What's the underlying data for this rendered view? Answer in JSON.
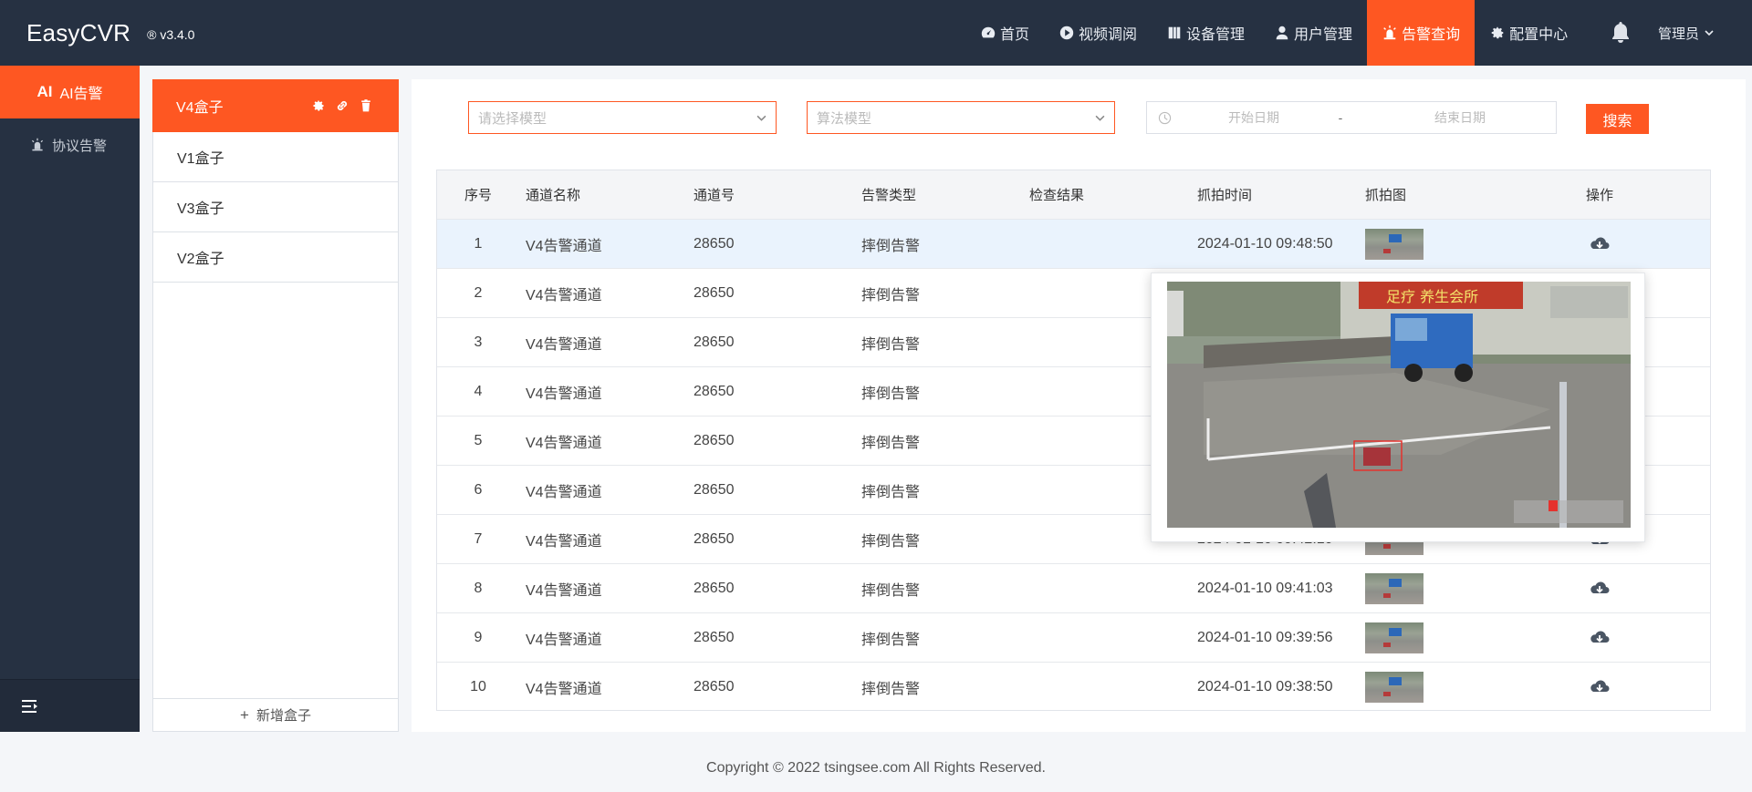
{
  "header": {
    "logo": "EasyCVR",
    "version": "® v3.4.0",
    "nav": [
      {
        "label": "首页",
        "icon": "dashboard-icon",
        "active": false
      },
      {
        "label": "视频调阅",
        "icon": "play-icon",
        "active": false
      },
      {
        "label": "设备管理",
        "icon": "book-icon",
        "active": false
      },
      {
        "label": "用户管理",
        "icon": "user-icon",
        "active": false
      },
      {
        "label": "告警查询",
        "icon": "alarm-icon",
        "active": true
      },
      {
        "label": "配置中心",
        "icon": "gear-icon",
        "active": false
      }
    ],
    "user": "管理员"
  },
  "sidebar": {
    "items": [
      {
        "label": "AI告警",
        "prefix": "AI",
        "active": true
      },
      {
        "label": "协议告警",
        "icon": "alarm-icon",
        "active": false
      }
    ]
  },
  "boxes": {
    "items": [
      {
        "label": "V4盒子",
        "active": true
      },
      {
        "label": "V1盒子",
        "active": false
      },
      {
        "label": "V3盒子",
        "active": false
      },
      {
        "label": "V2盒子",
        "active": false
      }
    ],
    "add_label": "新增盒子"
  },
  "filters": {
    "model_placeholder": "请选择模型",
    "algo_placeholder": "算法模型",
    "start_placeholder": "开始日期",
    "separator": "-",
    "end_placeholder": "结束日期",
    "search_label": "搜索"
  },
  "table": {
    "columns": [
      "序号",
      "通道名称",
      "通道号",
      "告警类型",
      "检查结果",
      "抓拍时间",
      "抓拍图",
      "操作"
    ],
    "rows": [
      {
        "no": "1",
        "name": "V4告警通道",
        "channel": "28650",
        "type": "摔倒告警",
        "result": "",
        "time": "2024-01-10 09:48:50"
      },
      {
        "no": "2",
        "name": "V4告警通道",
        "channel": "28650",
        "type": "摔倒告警",
        "result": "",
        "time": ""
      },
      {
        "no": "3",
        "name": "V4告警通道",
        "channel": "28650",
        "type": "摔倒告警",
        "result": "",
        "time": ""
      },
      {
        "no": "4",
        "name": "V4告警通道",
        "channel": "28650",
        "type": "摔倒告警",
        "result": "",
        "time": ""
      },
      {
        "no": "5",
        "name": "V4告警通道",
        "channel": "28650",
        "type": "摔倒告警",
        "result": "",
        "time": ""
      },
      {
        "no": "6",
        "name": "V4告警通道",
        "channel": "28650",
        "type": "摔倒告警",
        "result": "",
        "time": ""
      },
      {
        "no": "7",
        "name": "V4告警通道",
        "channel": "28650",
        "type": "摔倒告警",
        "result": "",
        "time": "2024-01-10 09:42:10"
      },
      {
        "no": "8",
        "name": "V4告警通道",
        "channel": "28650",
        "type": "摔倒告警",
        "result": "",
        "time": "2024-01-10 09:41:03"
      },
      {
        "no": "9",
        "name": "V4告警通道",
        "channel": "28650",
        "type": "摔倒告警",
        "result": "",
        "time": "2024-01-10 09:39:56"
      },
      {
        "no": "10",
        "name": "V4告警通道",
        "channel": "28650",
        "type": "摔倒告警",
        "result": "",
        "time": "2024-01-10 09:38:50"
      }
    ]
  },
  "popup": {
    "sign_text": "足疗 养生会所"
  },
  "footer": {
    "copyright": "Copyright © 2022 tsingsee.com All Rights Reserved."
  },
  "colors": {
    "accent": "#fe5722",
    "header_bg": "#263142",
    "row_highlight": "#eaf3fd"
  }
}
